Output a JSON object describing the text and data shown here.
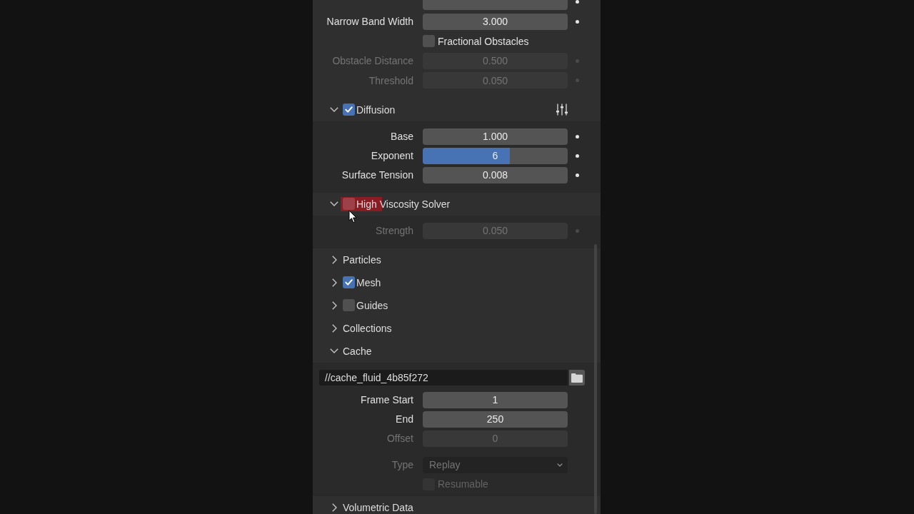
{
  "settings_rows": [
    {
      "kind": "number",
      "animatable": true,
      "disabled": false
    },
    {
      "kind": "number",
      "label": "Narrow Band Width",
      "value": "3.000",
      "animatable": true,
      "disabled": false
    },
    {
      "kind": "checkbox",
      "label": "Fractional Obstacles",
      "checked": false,
      "disabled": false
    },
    {
      "kind": "number",
      "label": "Obstacle Distance",
      "value": "0.500",
      "animatable": true,
      "disabled": true
    },
    {
      "kind": "number",
      "label": "Threshold",
      "value": "0.050",
      "animatable": true,
      "disabled": true
    }
  ],
  "panels": [
    {
      "label": "Diffusion",
      "expanded": true,
      "toggle": {
        "checked": true
      },
      "presets_menu": true,
      "highlighted": false,
      "hovered": false,
      "rows": [
        {
          "kind": "number",
          "label": "Base",
          "value": "1.000",
          "animatable": true,
          "disabled": false
        },
        {
          "kind": "slider",
          "label": "Exponent",
          "value": "6",
          "level": 0.6,
          "animatable": true,
          "disabled": false
        },
        {
          "kind": "number",
          "label": "Surface Tension",
          "value": "0.008",
          "animatable": true,
          "disabled": false
        }
      ]
    },
    {
      "label": "High Viscosity Solver",
      "expanded": true,
      "toggle": {
        "checked": false
      },
      "highlighted": true,
      "hovered": true,
      "rows": [
        {
          "kind": "number",
          "label": "Strength",
          "value": "0.050",
          "animatable": true,
          "disabled": true
        }
      ]
    },
    {
      "label": "Particles",
      "expanded": false,
      "highlighted": false,
      "hovered": false
    },
    {
      "label": "Mesh",
      "expanded": false,
      "toggle": {
        "checked": true
      },
      "highlighted": false,
      "hovered": false
    },
    {
      "label": "Guides",
      "expanded": false,
      "toggle": {
        "checked": false
      },
      "highlighted": false,
      "hovered": false
    },
    {
      "label": "Collections",
      "expanded": false,
      "highlighted": false,
      "hovered": false
    },
    {
      "label": "Cache",
      "expanded": true,
      "highlighted": false,
      "hovered": false,
      "rows": [
        {
          "kind": "path",
          "value": "//cache_fluid_4b85f272",
          "disabled": false
        },
        {
          "kind": "number",
          "label": "Frame Start",
          "value": "1",
          "animatable": false,
          "disabled": false
        },
        {
          "kind": "number",
          "label": "End",
          "value": "250",
          "animatable": false,
          "disabled": false
        },
        {
          "kind": "number",
          "label": "Offset",
          "value": "0",
          "animatable": false,
          "disabled": true
        },
        {
          "kind": "dropdown",
          "label": "Type",
          "value": "Replay",
          "disabled": true
        },
        {
          "kind": "checkbox",
          "label": "Resumable",
          "checked": false,
          "disabled": true
        }
      ]
    },
    {
      "label": "Volumetric Data",
      "expanded": false,
      "highlighted": false,
      "hovered": false
    }
  ]
}
